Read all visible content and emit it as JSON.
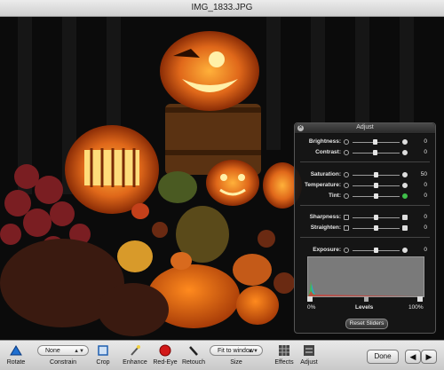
{
  "window": {
    "title": "IMG_1833.JPG"
  },
  "toolbar": {
    "rotate": "Rotate",
    "constrain_value": "None",
    "constrain": "Constrain",
    "crop": "Crop",
    "enhance": "Enhance",
    "red_eye": "Red-Eye",
    "retouch": "Retouch",
    "size_value": "Fit to window",
    "size": "Size",
    "effects": "Effects",
    "adjust": "Adjust",
    "done": "Done"
  },
  "adjust": {
    "title": "Adjust",
    "brightness": {
      "label": "Brightness:",
      "value": "0"
    },
    "contrast": {
      "label": "Contrast:",
      "value": "0"
    },
    "saturation": {
      "label": "Saturation:",
      "value": "50"
    },
    "temperature": {
      "label": "Temperature:",
      "value": "0"
    },
    "tint": {
      "label": "Tint:",
      "value": "0"
    },
    "sharpness": {
      "label": "Sharpness:",
      "value": "0"
    },
    "straighten": {
      "label": "Straighten:",
      "value": "0"
    },
    "exposure": {
      "label": "Exposure:",
      "value": "0"
    },
    "levels": {
      "min": "0%",
      "label": "Levels",
      "max": "100%"
    },
    "reset": "Reset Sliders"
  }
}
